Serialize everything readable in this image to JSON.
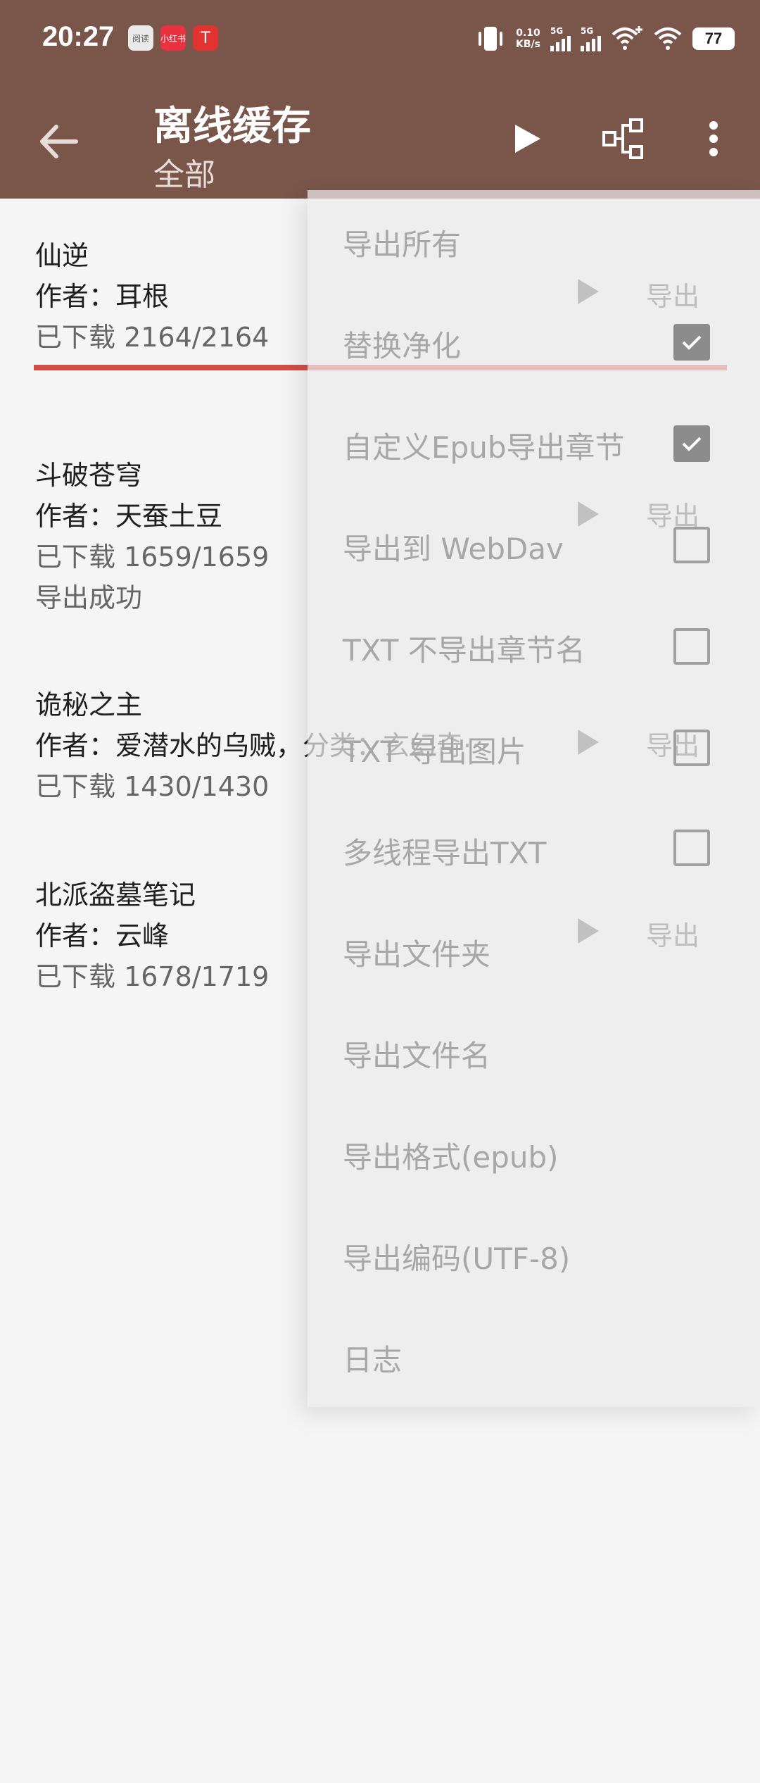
{
  "status_bar": {
    "time": "20:27",
    "app_icons": [
      "阅读",
      "小红书",
      "T"
    ],
    "net_speed_value": "0.10",
    "net_speed_unit": "KB/s",
    "signal1": "5G",
    "signal2": "5G",
    "battery": "77"
  },
  "toolbar": {
    "title": "离线缓存",
    "subtitle": "全部",
    "icons": [
      "back-arrow-icon",
      "play-icon",
      "tree-icon",
      "more-vert-icon"
    ]
  },
  "books": [
    {
      "title": "仙逆",
      "author": "作者：耳根",
      "downloaded": "已下载 2164/2164",
      "export_label": "导出",
      "progress": 1.0
    },
    {
      "title": "斗破苍穹",
      "author": "作者：天蚕土豆",
      "downloaded": "已下载 1659/1659",
      "status": "导出成功",
      "export_label": "导出"
    },
    {
      "title": "诡秘之主",
      "author": "作者：爱潜水的乌贼，分类：玄幻奇···",
      "downloaded": "已下载 1430/1430",
      "export_label": "导出"
    },
    {
      "title": "北派盗墓笔记",
      "author": "作者：云峰",
      "downloaded": "已下载 1678/1719",
      "export_label": "导出"
    }
  ],
  "menu": {
    "items": [
      {
        "label": "导出所有"
      },
      {
        "label": "替换净化",
        "checkbox": true,
        "checked": true
      },
      {
        "label": "自定义Epub导出章节",
        "checkbox": true,
        "checked": true
      },
      {
        "label": "导出到 WebDav",
        "checkbox": true,
        "checked": false
      },
      {
        "label": "TXT 不导出章节名",
        "checkbox": true,
        "checked": false
      },
      {
        "label": "TXT 导出图片",
        "checkbox": true,
        "checked": false
      },
      {
        "label": "多线程导出TXT",
        "checkbox": true,
        "checked": false
      },
      {
        "label": "导出文件夹"
      },
      {
        "label": "导出文件名"
      },
      {
        "label": "导出格式(epub)"
      },
      {
        "label": "导出编码(UTF-8)"
      },
      {
        "label": "日志"
      }
    ]
  },
  "colors": {
    "toolbar": "#79554a",
    "progress": "#d24d47",
    "background": "#f5f5f5"
  }
}
